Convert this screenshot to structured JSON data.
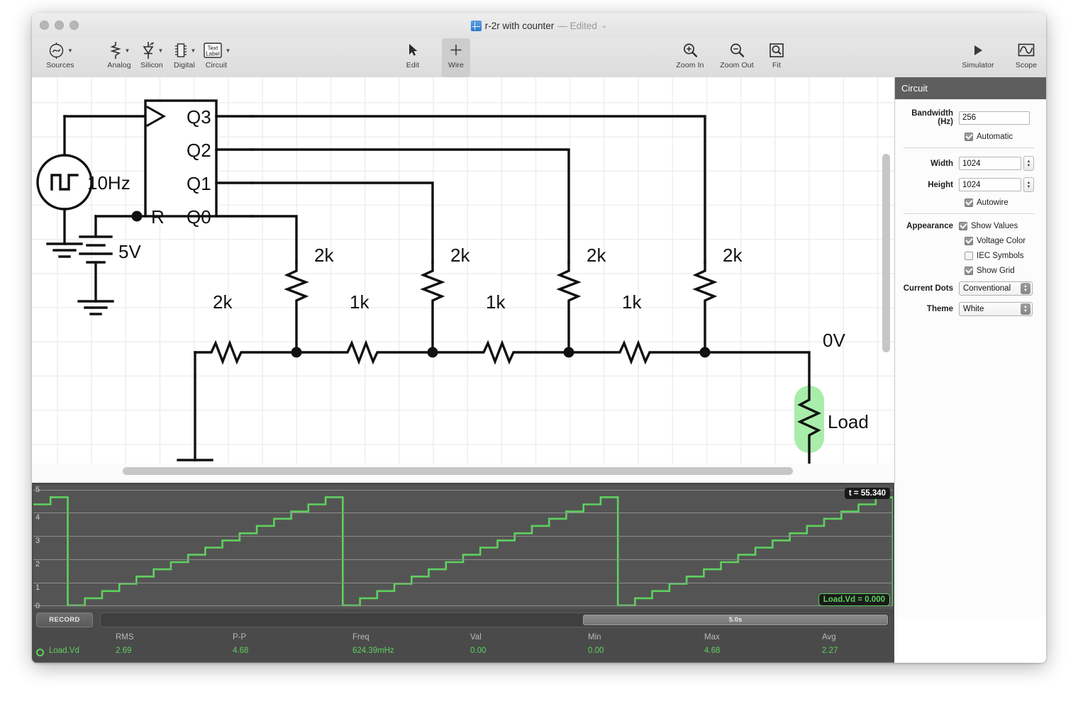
{
  "window": {
    "title": "r-2r with counter",
    "edited_suffix": "— Edited",
    "chevron": "⌄",
    "traffic_lights": [
      "close-button",
      "minimize-button",
      "zoom-button"
    ]
  },
  "toolbar": {
    "items": [
      {
        "label": "Sources",
        "icon": "ac-source-icon",
        "has_menu": true
      },
      {
        "label": "Analog",
        "icon": "resistor-icon",
        "has_menu": true
      },
      {
        "label": "Silicon",
        "icon": "led-diode-icon",
        "has_menu": true
      },
      {
        "label": "Digital",
        "icon": "ic-chip-icon",
        "has_menu": true
      },
      {
        "label": "Circuit",
        "icon": "text-label-icon",
        "has_menu": true,
        "icon_text": "Text\nLabel"
      }
    ],
    "modes": [
      {
        "label": "Edit",
        "icon": "cursor-arrow-icon",
        "active": false
      },
      {
        "label": "Wire",
        "icon": "plus-icon",
        "active": true
      }
    ],
    "zoom_tools": [
      {
        "label": "Zoom In",
        "icon": "magnifier-plus-icon"
      },
      {
        "label": "Zoom Out",
        "icon": "magnifier-minus-icon"
      },
      {
        "label": "Fit",
        "icon": "magnifier-fit-icon"
      }
    ],
    "right_tools": [
      {
        "label": "Simulator",
        "icon": "play-triangle-icon"
      },
      {
        "label": "Scope",
        "icon": "waveform-icon"
      }
    ]
  },
  "inspector": {
    "header": "Circuit",
    "bandwidth_label": "Bandwidth (Hz)",
    "bandwidth_value": "256",
    "automatic_label": "Automatic",
    "automatic_checked": true,
    "width_label": "Width",
    "width_value": "1024",
    "height_label": "Height",
    "height_value": "1024",
    "autowire_label": "Autowire",
    "autowire_checked": true,
    "appearance_label": "Appearance",
    "appearance_options": [
      {
        "label": "Show Values",
        "checked": true
      },
      {
        "label": "Voltage Color",
        "checked": true
      },
      {
        "label": "IEC Symbols",
        "checked": false
      },
      {
        "label": "Show Grid",
        "checked": true
      }
    ],
    "current_dots_label": "Current Dots",
    "current_dots_value": "Conventional",
    "theme_label": "Theme",
    "theme_value": "White"
  },
  "schematic": {
    "source": {
      "label": "10Hz",
      "type": "square-wave-source"
    },
    "battery": {
      "label": "5V",
      "type": "battery"
    },
    "ic": {
      "type": "counter",
      "clock_pin": "clock-triangle",
      "reset_pin": "R",
      "outputs": [
        "Q3",
        "Q2",
        "Q1",
        "Q0"
      ]
    },
    "ladder_series": [
      {
        "label": "2k"
      },
      {
        "label": "1k"
      },
      {
        "label": "1k"
      },
      {
        "label": "1k"
      }
    ],
    "ladder_shunt": [
      {
        "label": "2k"
      },
      {
        "label": "2k"
      },
      {
        "label": "2k"
      },
      {
        "label": "2k"
      }
    ],
    "node_label": "0V",
    "load": {
      "label": "Load",
      "highlight_color": "#a8edaa"
    }
  },
  "scope": {
    "y_ticks": [
      "5",
      "4",
      "3",
      "2",
      "1",
      "0"
    ],
    "time_badge": "t = 55.340",
    "value_badge": "Load.Vd = 0.000",
    "record_label": "RECORD",
    "timebase": "5.0s",
    "trace_color": "#5ed15e",
    "measurement_headers": [
      "RMS",
      "P-P",
      "Freq",
      "Val",
      "Min",
      "Max",
      "Avg"
    ],
    "traces": [
      {
        "name": "Load.Vd",
        "values": [
          "2.69",
          "4.68",
          "624.39mHz",
          "0.00",
          "0.00",
          "4.68",
          "2.27"
        ]
      }
    ]
  },
  "chart_data": {
    "type": "line",
    "title": "Load.Vd",
    "xlabel": "",
    "ylabel": "",
    "ylim": [
      0,
      5
    ],
    "y_ticks": [
      0,
      1,
      2,
      3,
      4,
      5
    ],
    "grid": true,
    "legend": "none",
    "description": "4-bit R-2R DAC staircase ramp: 16 steps from 0 V to 4.68 V, repeating sawtooth",
    "steps_per_cycle": 16,
    "step_volts": 0.3125,
    "cycles_visible": 3.2,
    "annotations": [
      "t = 55.340",
      "Load.Vd = 0.000"
    ],
    "series": [
      {
        "name": "Load.Vd",
        "color": "#5ed15e",
        "values": [
          4.37,
          4.68,
          0.0,
          0.31,
          0.62,
          0.94,
          1.25,
          1.56,
          1.87,
          2.19,
          2.5,
          2.81,
          3.12,
          3.44,
          3.75,
          4.06,
          4.37,
          4.68,
          0.0,
          0.31,
          0.62,
          0.94,
          1.25,
          1.56,
          1.87,
          2.19,
          2.5,
          2.81,
          3.12,
          3.44,
          3.75,
          4.06,
          4.37,
          4.68,
          0.0,
          0.31,
          0.62,
          0.94,
          1.25,
          1.56,
          1.87,
          2.19,
          2.5,
          2.81,
          3.12,
          3.44,
          3.75,
          4.06,
          4.37,
          4.68,
          0.0
        ]
      }
    ]
  }
}
